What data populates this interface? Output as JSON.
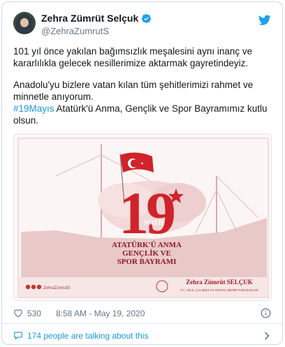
{
  "author": {
    "display_name": "Zehra Zümrüt Selçuk",
    "handle": "@ZehraZumrutS"
  },
  "tweet": {
    "paragraph1": "101 yıl önce yakılan bağımsızlık meşalesini aynı inanç ve kararlılıkla gelecek nesillerimize aktarmak gayretindeyiz.",
    "paragraph2_line1": "Anadolu'yu bizlere vatan kılan tüm şehitlerimizi rahmet ve minnetle anıyorum.",
    "hashtag": "#19Mayıs",
    "paragraph2_tail": " Atatürk'ü Anma, Gençlik ve Spor Bayramımız kutlu olsun."
  },
  "media": {
    "day_number": "19",
    "month": "MAYIS",
    "line1": "ATATÜRK'Ü ANMA",
    "line2": "GENÇLİK VE",
    "line3": "SPOR BAYRAMI",
    "signature_name": "Zehra Zümrüt SELÇUK",
    "signature_title": "T.C. AİLE, ÇALIŞMA VE SOSYAL HİZMETLER BAKANI",
    "social_handle": "ZehraZumrutS"
  },
  "meta": {
    "like_count": "530",
    "timestamp": "8:58 AM - May 19, 2020"
  },
  "footer": {
    "talking_text": "174 people are talking about this"
  },
  "colors": {
    "accent": "#1b95e0",
    "flag_red": "#d0232a",
    "ship_pink": "#e9c8c8"
  }
}
